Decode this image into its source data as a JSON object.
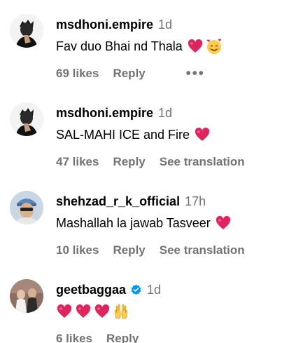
{
  "comments": [
    {
      "username": "msdhoni.empire",
      "time": "1d",
      "text": "Fav duo Bhai nd Thala",
      "emojis": [
        "red-heart",
        "smiling-face-with-hearts"
      ],
      "likes": "69 likes",
      "reply": "Reply",
      "more": "•••"
    },
    {
      "username": "msdhoni.empire",
      "time": "1d",
      "text": "SAL-MAHI ICE and Fire",
      "emojis": [
        "red-heart"
      ],
      "likes": "47 likes",
      "reply": "Reply",
      "translation": "See translation"
    },
    {
      "username": "shehzad_r_k_official",
      "time": "17h",
      "text": "Mashallah la jawab Tasveer",
      "emojis": [
        "red-heart"
      ],
      "likes": "10 likes",
      "reply": "Reply",
      "translation": "See translation"
    },
    {
      "username": "geetbaggaa",
      "time": "1d",
      "verified": true,
      "text": "",
      "emojis": [
        "red-heart",
        "red-heart",
        "red-heart",
        "raising-hands"
      ],
      "likes": "6 likes",
      "reply": "Reply"
    }
  ],
  "colors": {
    "secondary_text": "#737373",
    "heart": "#e0245e",
    "verified": "#0095f6"
  }
}
